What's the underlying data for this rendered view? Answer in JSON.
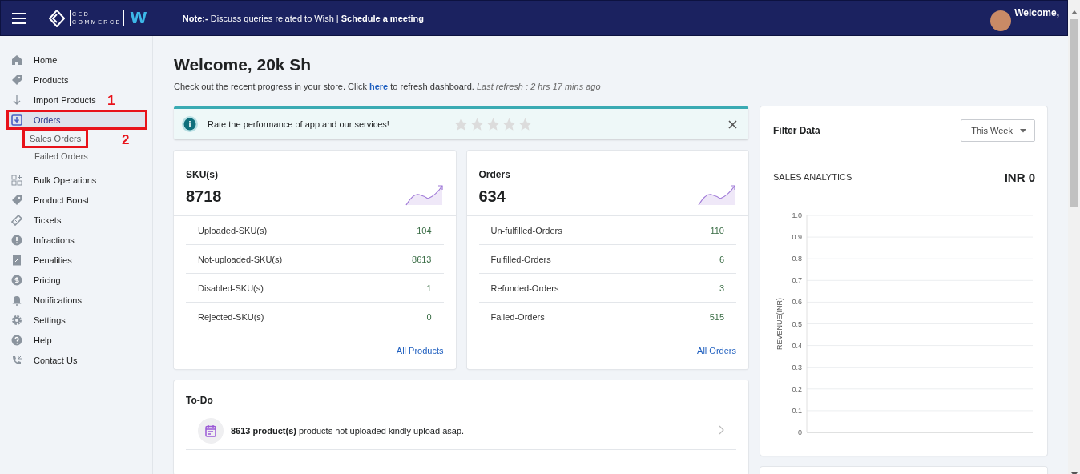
{
  "header": {
    "logo_top": "CED",
    "logo_bottom": "COMMERCE",
    "logo_mark": "w",
    "note": "**Note:-** Discuss queries related to Wish | **Schedule a meeting**",
    "welcome": "Welcome,"
  },
  "sidebar": {
    "items": [
      {
        "label": "Home",
        "selected": false
      },
      {
        "label": "Products",
        "selected": false
      },
      {
        "label": "Import Products",
        "selected": false
      },
      {
        "label": "Orders",
        "selected": true,
        "callout": "1",
        "children": [
          {
            "label": "Sales Orders",
            "selected": false,
            "callout": "2"
          },
          {
            "label": "Failed Orders",
            "selected": false
          }
        ]
      },
      {
        "label": "Bulk Operations",
        "selected": false
      },
      {
        "label": "Product Boost",
        "selected": false
      },
      {
        "label": "Tickets",
        "selected": false
      },
      {
        "label": "Infractions",
        "selected": false
      },
      {
        "label": "Penalities",
        "selected": false
      },
      {
        "label": "Pricing",
        "selected": false
      },
      {
        "label": "Notifications",
        "selected": false
      },
      {
        "label": "Settings",
        "selected": false
      },
      {
        "label": "Help",
        "selected": false
      },
      {
        "label": "Contact Us",
        "selected": false
      }
    ]
  },
  "title": "Welcome, 20k Sh",
  "subtitle": {
    "before": "Check out the recent progress in your store. Click",
    "link": "here",
    "after": "to refresh dashboard.",
    "last_refresh": "Last refresh : 2 hrs 17 mins ago"
  },
  "rating": {
    "text": "Rate the performance of app and our services!",
    "stars": 0
  },
  "stat_cards": [
    {
      "title": "SKU(s)",
      "value": "8718",
      "link": "All Products",
      "rows": [
        {
          "label": "Uploaded-SKU(s)",
          "value": "104"
        },
        {
          "label": "Not-uploaded-SKU(s)",
          "value": "8613"
        },
        {
          "label": "Disabled-SKU(s)",
          "value": "1"
        },
        {
          "label": "Rejected-SKU(s)",
          "value": "0"
        }
      ]
    },
    {
      "title": "Orders",
      "value": "634",
      "link": "All Orders",
      "rows": [
        {
          "label": "Un-fulfilled-Orders",
          "value": "110"
        },
        {
          "label": "Fulfilled-Orders",
          "value": "6"
        },
        {
          "label": "Refunded-Orders",
          "value": "3"
        },
        {
          "label": "Failed-Orders",
          "value": "515"
        }
      ]
    }
  ],
  "todo": {
    "title": "To-Do",
    "items": [
      {
        "text": "**8613 product(s)** products not uploaded kindly upload asap."
      }
    ]
  },
  "filter": {
    "title": "Filter Data",
    "period": "This Week"
  },
  "sales": {
    "title": "SALES ANALYTICS",
    "total": "INR 0",
    "axis_title": "REVENUE(INR)",
    "axis_labels": [
      "1.0",
      "0.9",
      "0.8",
      "0.7",
      "0.6",
      "0.5",
      "0.4",
      "0.3",
      "0.2",
      "0.1",
      "0"
    ]
  }
}
